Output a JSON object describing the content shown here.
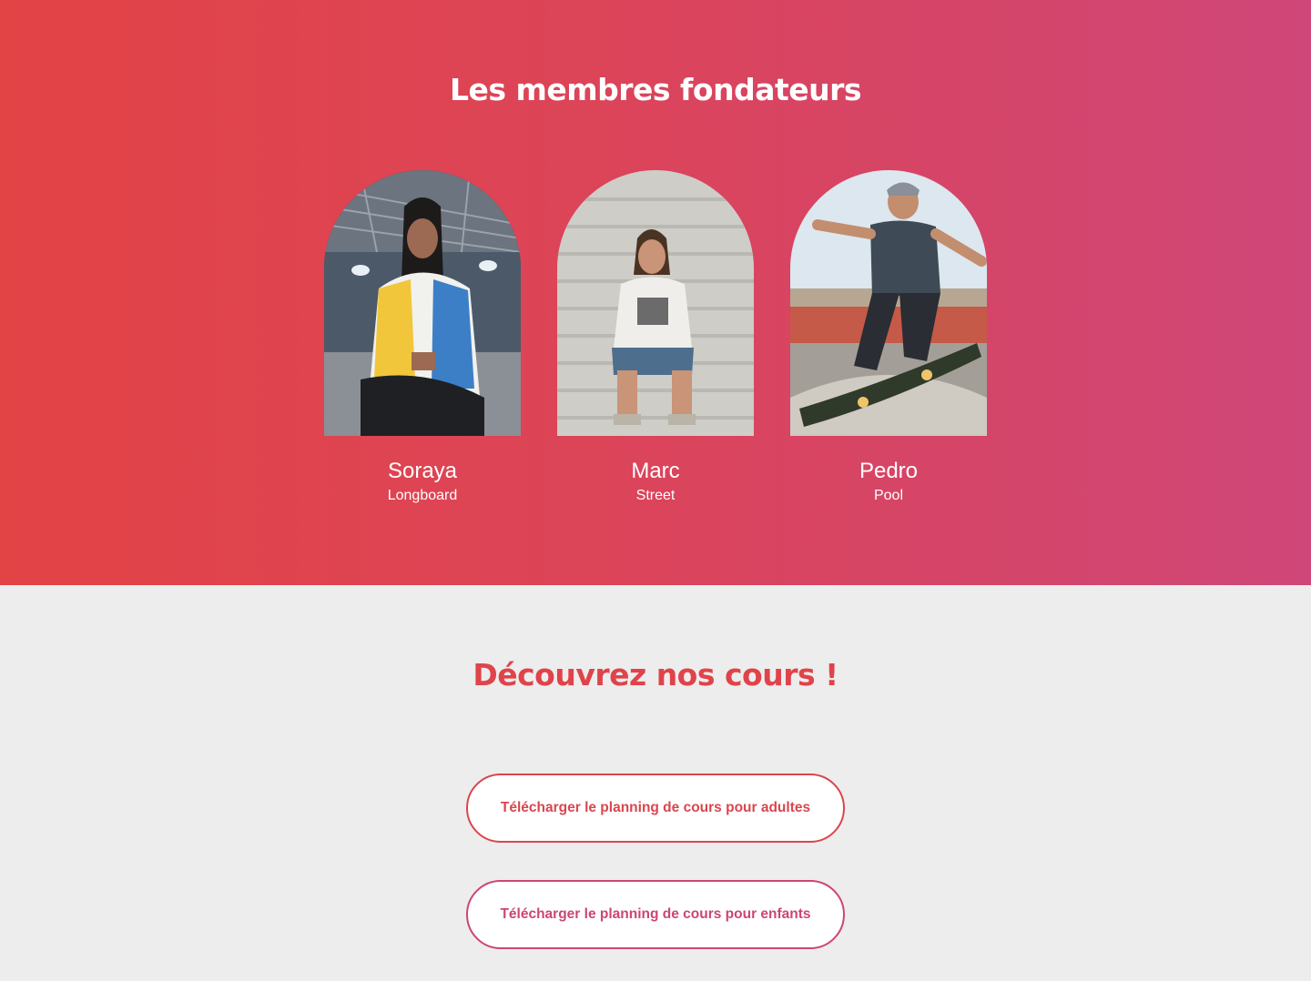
{
  "founders": {
    "title": "Les membres fondateurs",
    "members": [
      {
        "name": "Soraya",
        "style": "Longboard",
        "photo": "portrait-photo-woman-in-skate-hall"
      },
      {
        "name": "Marc",
        "style": "Street",
        "photo": "portrait-photo-man-sitting-on-stairs"
      },
      {
        "name": "Pedro",
        "style": "Pool",
        "photo": "photo-skater-doing-trick"
      }
    ]
  },
  "courses": {
    "title": "Découvrez nos cours !",
    "buttons": {
      "adults": "Télécharger le planning de cours pour adultes",
      "kids": "Télécharger le planning de cours pour enfants"
    }
  },
  "colors": {
    "gradient_start": "#e24345",
    "gradient_end": "#cf4678",
    "accent_red": "#e0434a",
    "accent_pink": "#cc4673",
    "light_background": "#ededed"
  }
}
